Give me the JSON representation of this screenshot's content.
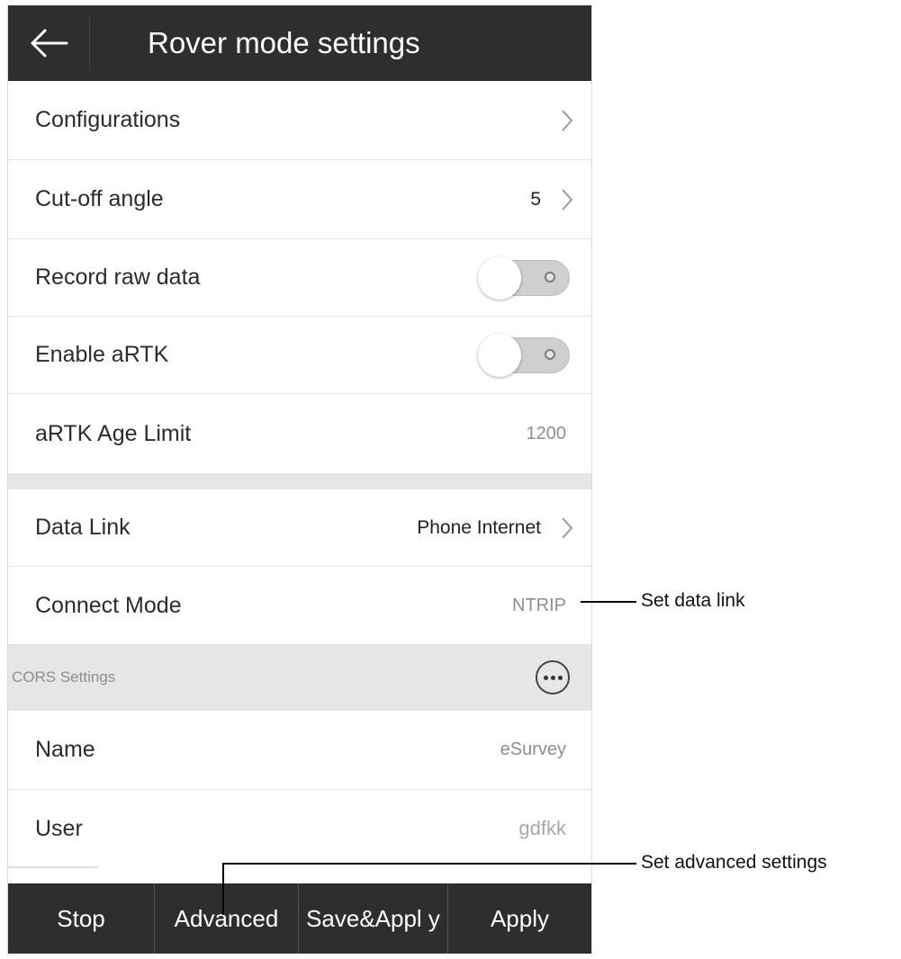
{
  "header": {
    "title": "Rover mode settings",
    "back_icon": "arrow-left-icon"
  },
  "rows": {
    "configurations": {
      "label": "Configurations"
    },
    "cutoff_angle": {
      "label": "Cut-off angle",
      "value": "5"
    },
    "record_raw_data": {
      "label": "Record raw data",
      "toggle_on": false
    },
    "enable_artk": {
      "label": "Enable aRTK",
      "toggle_on": false
    },
    "artk_age_limit": {
      "label": "aRTK Age Limit",
      "value": "1200"
    },
    "data_link": {
      "label": "Data Link",
      "value": "Phone Internet"
    },
    "connect_mode": {
      "label": "Connect Mode",
      "value": "NTRIP"
    }
  },
  "cors_section": {
    "label": "CORS Settings",
    "more_icon": "more-horizontal-icon",
    "name": {
      "label": "Name",
      "value": "eSurvey"
    },
    "user": {
      "label": "User",
      "value": "gdfkk"
    }
  },
  "bottom_bar": {
    "stop": "Stop",
    "advanced": "Advanced",
    "save_apply": "Save&Appl y",
    "apply": "Apply"
  },
  "annotations": {
    "set_data_link": "Set data link",
    "set_advanced": "Set advanced settings"
  },
  "colors": {
    "bar_background": "#2e2e2e",
    "section_background": "#e6e6e6",
    "secondary_text": "#8e8e8e"
  }
}
